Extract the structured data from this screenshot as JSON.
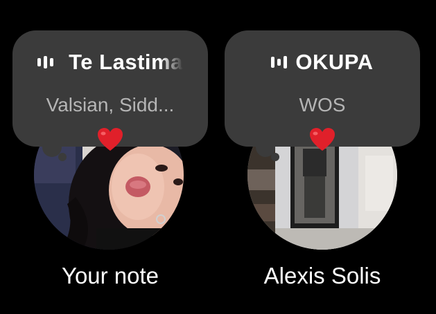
{
  "notes": [
    {
      "song_title": "Te Lastima",
      "artist": "Valsian, Sidd...",
      "emoji": "heart",
      "caption": "Your note",
      "colors": {
        "bubble": "#3b3b3b",
        "heart": "#e0202a"
      }
    },
    {
      "song_title": "OKUPA",
      "artist": "WOS",
      "emoji": "heart",
      "caption": "Alexis Solis",
      "colors": {
        "bubble": "#3b3b3b",
        "heart": "#e0202a"
      }
    }
  ],
  "icons": {
    "music": "audio-bars-icon",
    "reaction": "red-heart-icon"
  }
}
